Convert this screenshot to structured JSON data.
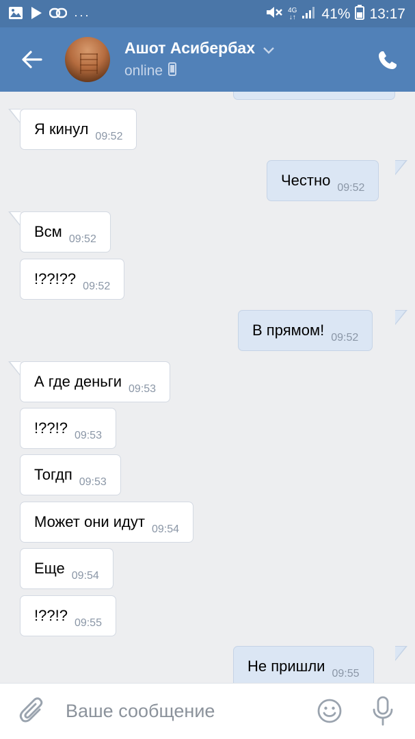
{
  "status_bar": {
    "battery_percent": "41%",
    "time": "13:17",
    "network_top": "4G",
    "network_bottom": "↓↑",
    "more_dots": "···",
    "bg_color": "#4a76a8"
  },
  "header": {
    "contact_name": "Ашот Асибербах",
    "status": "online",
    "bg_color": "#5181b8"
  },
  "messages": [
    {
      "direction": "in",
      "text": "Я кинул",
      "time": "09:52"
    },
    {
      "direction": "out",
      "text": "Честно",
      "time": "09:52"
    },
    {
      "direction": "in",
      "text": "Всм",
      "time": "09:52"
    },
    {
      "direction": "in",
      "text": "!??!??",
      "time": "09:52"
    },
    {
      "direction": "out",
      "text": "В прямом!",
      "time": "09:52"
    },
    {
      "direction": "in",
      "text": "А где деньги",
      "time": "09:53"
    },
    {
      "direction": "in",
      "text": "!??!?",
      "time": "09:53"
    },
    {
      "direction": "in",
      "text": "Тогдп",
      "time": "09:53"
    },
    {
      "direction": "in",
      "text": "Может они идут",
      "time": "09:54"
    },
    {
      "direction": "in",
      "text": "Еще",
      "time": "09:54"
    },
    {
      "direction": "in",
      "text": "!??!?",
      "time": "09:55"
    },
    {
      "direction": "out",
      "text": "Не пришли",
      "time": "09:55"
    }
  ],
  "composer": {
    "placeholder": "Ваше сообщение",
    "value": ""
  },
  "icons": {
    "status_left": [
      "image-icon",
      "play-icon",
      "link-icon"
    ],
    "status_right": [
      "mute-icon",
      "signal-icon",
      "battery-icon"
    ],
    "header": [
      "back-arrow-icon",
      "chevron-down-icon",
      "mobile-icon",
      "phone-icon"
    ],
    "composer": [
      "attach-icon",
      "emoji-icon",
      "microphone-icon"
    ]
  }
}
